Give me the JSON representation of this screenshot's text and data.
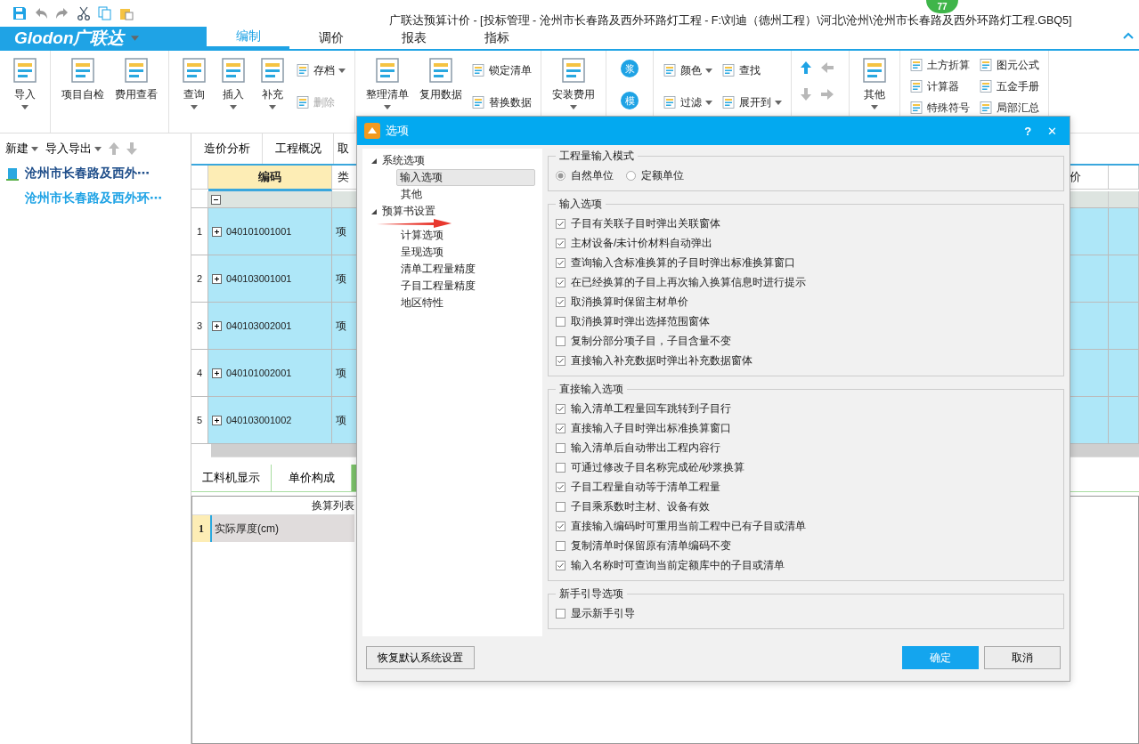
{
  "window": {
    "title": "广联达预算计价 - [投标管理 - 沧州市长春路及西外环路灯工程 - F:\\刘迪（德州工程）\\河北\\沧州\\沧州市长春路及西外环路灯工程.GBQ5]",
    "badge": "77"
  },
  "logo": {
    "text": "Glodon广联达"
  },
  "menu_tabs": [
    {
      "label": "编制",
      "selected": true
    },
    {
      "label": "调价",
      "selected": false
    },
    {
      "label": "报表",
      "selected": false
    },
    {
      "label": "指标",
      "selected": false
    }
  ],
  "ribbon": [
    {
      "items": [
        {
          "kind": "big",
          "label": "导入",
          "dropdown": true
        }
      ]
    },
    {
      "items": [
        {
          "kind": "big",
          "label": "项目自检",
          "dropdown": false
        },
        {
          "kind": "big",
          "label": "费用查看",
          "dropdown": false
        }
      ]
    },
    {
      "items": [
        {
          "kind": "big",
          "label": "查询",
          "dropdown": true
        },
        {
          "kind": "big",
          "label": "插入",
          "dropdown": true
        },
        {
          "kind": "big",
          "label": "补充",
          "dropdown": true
        },
        {
          "kind": "small",
          "label": "存档",
          "dropdown": true,
          "disabled": false
        },
        {
          "kind": "small",
          "label": "删除",
          "dropdown": false,
          "disabled": true
        }
      ]
    },
    {
      "items": [
        {
          "kind": "big",
          "label": "整理清单",
          "dropdown": true
        },
        {
          "kind": "big",
          "label": "复用数据",
          "dropdown": false
        },
        {
          "kind": "small",
          "label": "锁定清单",
          "dropdown": false,
          "disabled": false
        },
        {
          "kind": "small",
          "label": "替换数据",
          "dropdown": false,
          "disabled": false
        }
      ]
    },
    {
      "items": [
        {
          "kind": "big",
          "label": "安装费用",
          "dropdown": true
        }
      ]
    },
    {
      "items": [
        {
          "kind": "glyph",
          "label": "浆"
        },
        {
          "kind": "glyph",
          "label": "模"
        }
      ]
    },
    {
      "items": [
        {
          "kind": "small",
          "label": "颜色",
          "dropdown": true,
          "disabled": false
        },
        {
          "kind": "small",
          "label": "过滤",
          "dropdown": true,
          "disabled": false
        },
        {
          "kind": "small",
          "label": "查找",
          "dropdown": false,
          "disabled": false
        },
        {
          "kind": "small",
          "label": "展开到",
          "dropdown": true,
          "disabled": false
        }
      ]
    },
    {
      "items": [
        {
          "kind": "up",
          "disabled": false
        },
        {
          "kind": "down",
          "disabled": true
        },
        {
          "kind": "left",
          "disabled": true
        },
        {
          "kind": "right",
          "disabled": true
        }
      ]
    },
    {
      "items": [
        {
          "kind": "big",
          "label": "其他",
          "dropdown": true
        }
      ]
    },
    {
      "items": [
        {
          "kind": "small",
          "label": "土方折算",
          "dropdown": false,
          "disabled": false
        },
        {
          "kind": "small",
          "label": "计算器",
          "dropdown": false,
          "disabled": false
        },
        {
          "kind": "small",
          "label": "特殊符号",
          "dropdown": false,
          "disabled": false
        },
        {
          "kind": "small",
          "label": "图元公式",
          "dropdown": false,
          "disabled": false
        },
        {
          "kind": "small",
          "label": "五金手册",
          "dropdown": false,
          "disabled": false
        },
        {
          "kind": "small",
          "label": "局部汇总",
          "dropdown": false,
          "disabled": false
        }
      ]
    }
  ],
  "sidebar": {
    "actions": [
      {
        "label": "新建"
      },
      {
        "label": "导入导出"
      }
    ],
    "tree": [
      {
        "label": "沧州市长春路及西外⋯",
        "children": [
          {
            "label": "沧州市长春路及西外环⋯",
            "selected": true
          }
        ]
      }
    ]
  },
  "content_tabs": [
    {
      "label": "造价分析"
    },
    {
      "label": "工程概况"
    },
    {
      "label": "取"
    }
  ],
  "table": {
    "columns": [
      "编码",
      "类",
      "价"
    ],
    "rows": [
      {
        "number": "1",
        "code": "040101001001",
        "type": "项"
      },
      {
        "number": "2",
        "code": "040103001001",
        "type": "项"
      },
      {
        "number": "3",
        "code": "040103002001",
        "type": "项"
      },
      {
        "number": "4",
        "code": "040101002001",
        "type": "项"
      },
      {
        "number": "5",
        "code": "040103001002",
        "type": "项"
      }
    ]
  },
  "bottom_tabs": [
    {
      "label": "工料机显示"
    },
    {
      "label": "单价构成"
    }
  ],
  "conversion_table": {
    "header": "换算列表",
    "rows": [
      {
        "number": "1",
        "name": "实际厚度(cm)"
      }
    ]
  },
  "dialog": {
    "title": "选项",
    "help": "?",
    "close": "✕",
    "tree": [
      {
        "label": "系统选项",
        "children": [
          {
            "label": "输入选项",
            "selected": true
          },
          {
            "label": "其他",
            "selected": false
          }
        ]
      },
      {
        "label": "预算书设置",
        "children": [
          {
            "label": "计算选项",
            "selected": false
          },
          {
            "label": "呈现选项",
            "selected": false
          },
          {
            "label": "清单工程量精度",
            "selected": false
          },
          {
            "label": "子目工程量精度",
            "selected": false
          },
          {
            "label": "地区特性",
            "selected": false
          }
        ]
      }
    ],
    "groups": [
      {
        "title": "工程量输入模式",
        "kind": "radio",
        "options": [
          {
            "label": "自然单位",
            "selected": true
          },
          {
            "label": "定额单位",
            "selected": false
          }
        ]
      },
      {
        "title": "输入选项",
        "kind": "checkbox",
        "options": [
          {
            "label": "子目有关联子目时弹出关联窗体",
            "checked": true
          },
          {
            "label": "主材设备/未计价材料自动弹出",
            "checked": true
          },
          {
            "label": "查询输入含标准换算的子目时弹出标准换算窗口",
            "checked": true
          },
          {
            "label": "在已经换算的子目上再次输入换算信息时进行提示",
            "checked": true
          },
          {
            "label": "取消换算时保留主材单价",
            "checked": true
          },
          {
            "label": "取消换算时弹出选择范围窗体",
            "checked": false
          },
          {
            "label": "复制分部分项子目，子目含量不变",
            "checked": false
          },
          {
            "label": "直接输入补充数据时弹出补充数据窗体",
            "checked": true
          }
        ]
      },
      {
        "title": "直接输入选项",
        "kind": "checkbox",
        "options": [
          {
            "label": "输入清单工程量回车跳转到子目行",
            "checked": true
          },
          {
            "label": "直接输入子目时弹出标准换算窗口",
            "checked": true
          },
          {
            "label": "输入清单后自动带出工程内容行",
            "checked": false
          },
          {
            "label": "可通过修改子目名称完成砼/砂浆换算",
            "checked": false
          },
          {
            "label": "子目工程量自动等于清单工程量",
            "checked": true
          },
          {
            "label": "子目乘系数时主材、设备有效",
            "checked": false
          },
          {
            "label": "直接输入编码时可重用当前工程中已有子目或清单",
            "checked": true
          },
          {
            "label": "复制清单时保留原有清单编码不变",
            "checked": false
          },
          {
            "label": "输入名称时可查询当前定额库中的子目或清单",
            "checked": true
          }
        ]
      },
      {
        "title": "新手引导选项",
        "kind": "checkbox",
        "options": [
          {
            "label": "显示新手引导",
            "checked": false
          }
        ]
      }
    ],
    "buttons": [
      {
        "label": "恢复默认系统设置",
        "kind": "secondary"
      },
      {
        "label": "确定",
        "kind": "primary"
      },
      {
        "label": "取消",
        "kind": "secondary"
      }
    ]
  }
}
